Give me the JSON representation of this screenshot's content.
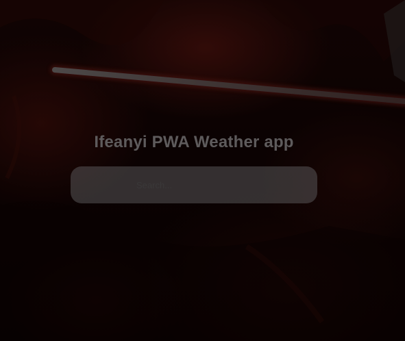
{
  "app": {
    "title": "Ifeanyi PWA Weather app"
  },
  "search": {
    "value": "",
    "placeholder": "Search..."
  },
  "colors": {
    "title": "#5e5b5c",
    "search_background": "#585658",
    "background": "#0a0203"
  }
}
